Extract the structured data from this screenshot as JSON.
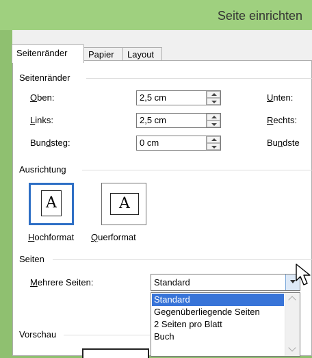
{
  "window": {
    "title": "Seite einrichten"
  },
  "tabs": [
    {
      "label": "Seitenränder",
      "active": true
    },
    {
      "label": "Papier",
      "active": false
    },
    {
      "label": "Layout",
      "active": false
    }
  ],
  "margins": {
    "group_label": "Seitenränder",
    "top_label": "Oben:",
    "top_value": "2,5 cm",
    "left_label": "Links:",
    "left_value": "2,5 cm",
    "gutter_label": "Bundsteg:",
    "gutter_value": "0 cm",
    "bottom_label": "Unten:",
    "right_label": "Rechts:",
    "gutter_pos_label": "Bundste"
  },
  "orientation": {
    "group_label": "Ausrichtung",
    "portrait_label": "Hochformat",
    "landscape_label": "Querformat",
    "glyph": "A"
  },
  "pages": {
    "group_label": "Seiten",
    "multiple_label": "Mehrere Seiten:",
    "selected": "Standard",
    "options": [
      "Standard",
      "Gegenüberliegende Seiten",
      "2 Seiten pro Blatt",
      "Buch"
    ]
  },
  "preview": {
    "group_label": "Vorschau"
  },
  "colors": {
    "title_bar": "#9fd07f",
    "selection": "#3874d8",
    "focus_border": "#2e6fc5"
  }
}
